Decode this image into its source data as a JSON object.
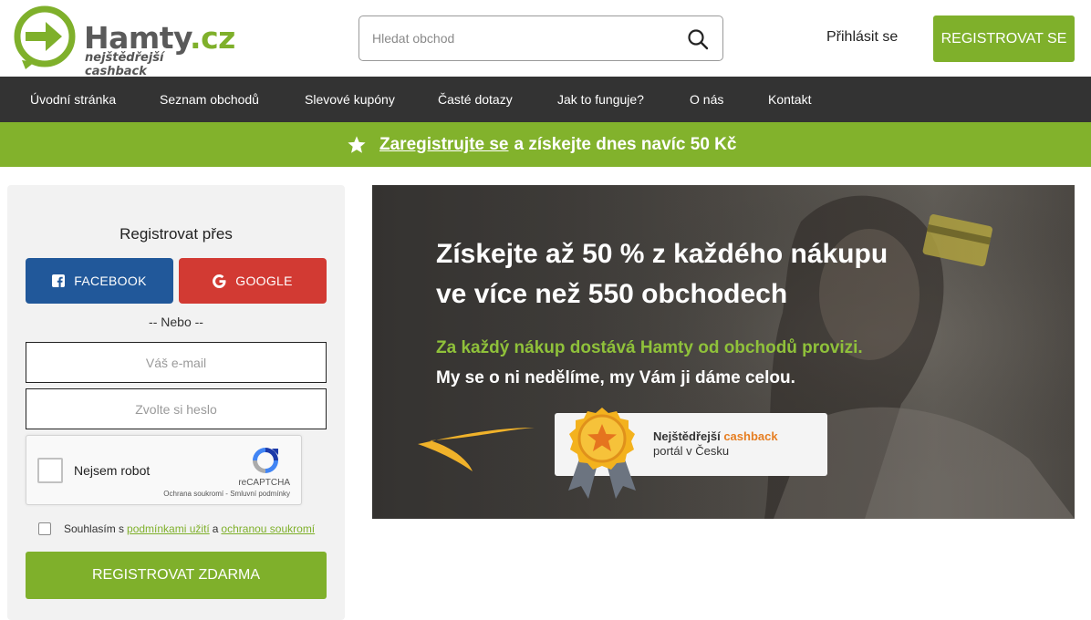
{
  "brand": {
    "name_main": "Hamty",
    "name_tld": ".cz",
    "tagline": "nejštědřejší cashback",
    "green": "#7fb02b",
    "dark_nav": "#333333"
  },
  "search": {
    "placeholder": "Hledat obchod",
    "icon": "search-icon"
  },
  "header": {
    "login_label": "Přihlásit se",
    "register_label": "REGISTROVAT SE"
  },
  "nav": {
    "items": [
      {
        "label": "Úvodní stránka"
      },
      {
        "label": "Seznam obchodů"
      },
      {
        "label": "Slevové kupóny"
      },
      {
        "label": "Časté dotazy"
      },
      {
        "label": "Jak to funguje?"
      },
      {
        "label": "O nás"
      },
      {
        "label": "Kontakt"
      }
    ]
  },
  "promo": {
    "icon": "star-icon",
    "link_text": "Zaregistrujte se",
    "rest_text": "a získejte dnes navíc 50 Kč"
  },
  "signup": {
    "title": "Registrovat přes",
    "facebook_label": "FACEBOOK",
    "google_label": "GOOGLE",
    "or_text": "-- Nebo --",
    "email_placeholder": "Váš e-mail",
    "password_placeholder": "Zvolte si heslo",
    "captcha": {
      "label": "Nejsem robot",
      "brand": "reCAPTCHA",
      "links": "Ochrana soukromí - Smluvní podmínky"
    },
    "agree": {
      "prefix": "Souhlasím s",
      "terms_link": "podmínkami užití",
      "and": "a",
      "privacy_link": "ochranou soukromí"
    },
    "submit_label": "REGISTROVAT ZDARMA"
  },
  "hero": {
    "headline_line1": "Získejte až 50 % z každého nákupu",
    "headline_line2": "ve více než 550 obchodech",
    "green_line": "Za každý nákup dostává Hamty od obchodů provizi.",
    "white_line": "My se o ni nedělíme, my Vám ji dáme celou.",
    "badge": {
      "bold": "Nejštědřejší",
      "orange": "cashback",
      "line2": "portál v Česku"
    }
  }
}
